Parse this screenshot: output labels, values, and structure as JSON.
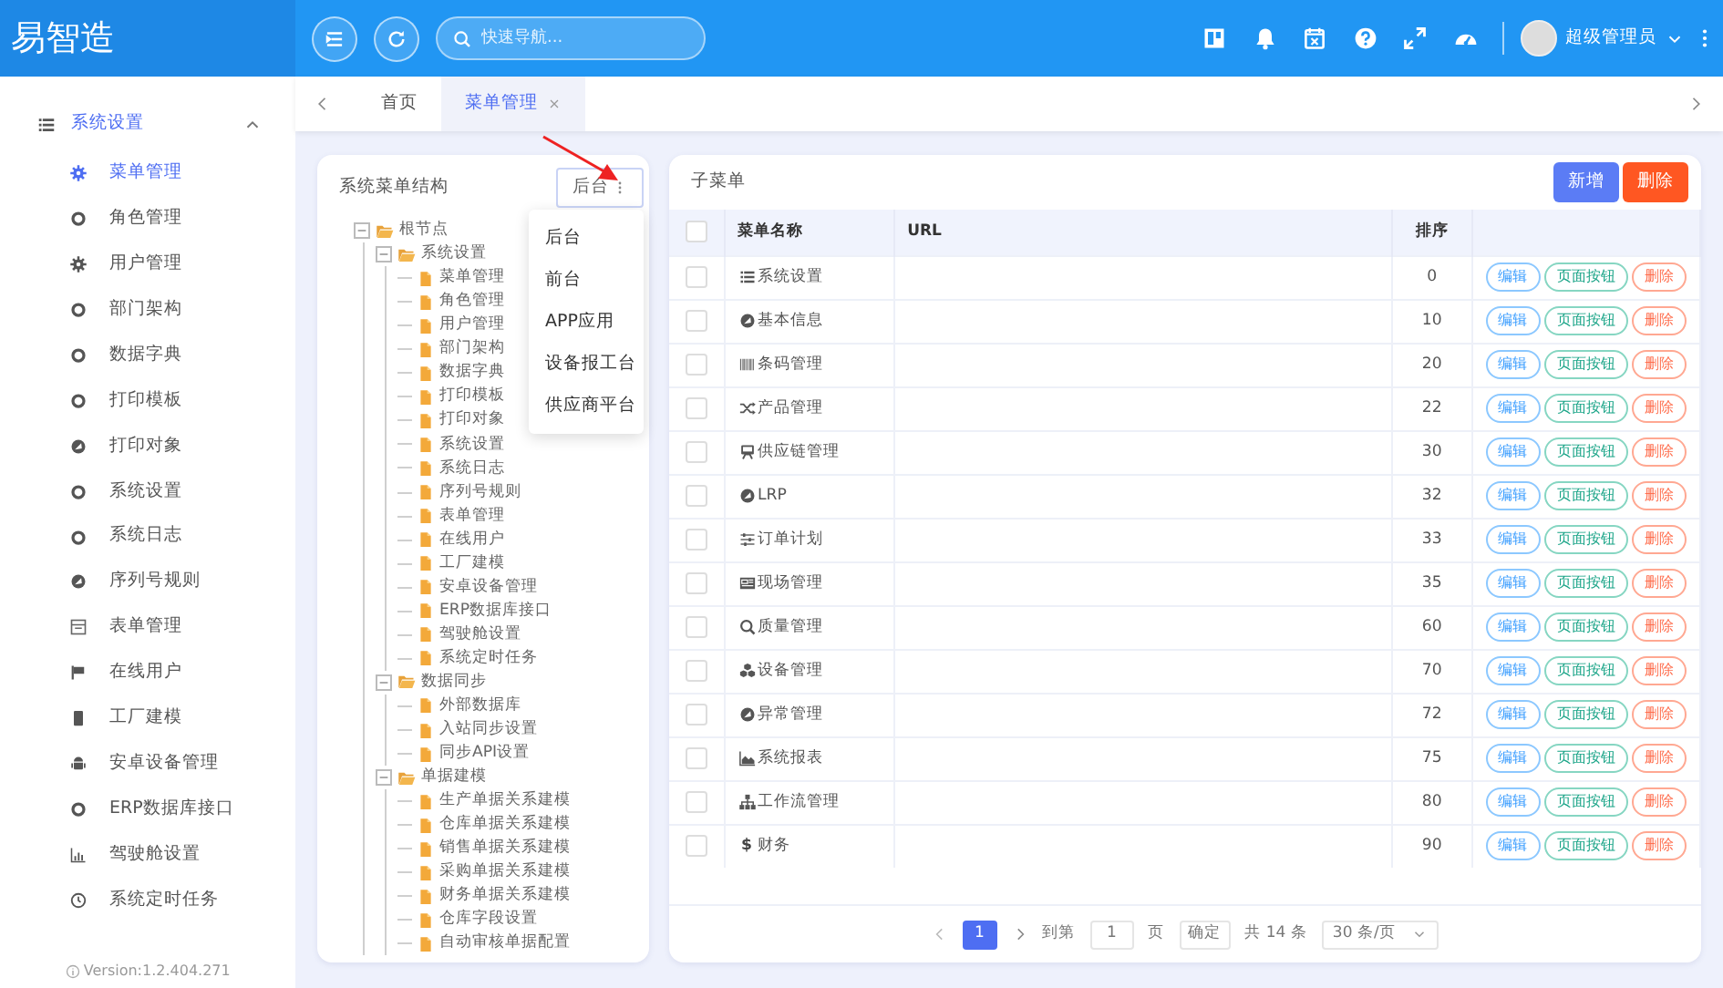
{
  "app": {
    "logo": "易智造"
  },
  "header": {
    "search_placeholder": "快速导航...",
    "user": "超级管理员"
  },
  "sidebar": {
    "group": {
      "label": "系统设置",
      "expanded": true
    },
    "items": [
      {
        "label": "菜单管理",
        "selected": true
      },
      {
        "label": "角色管理",
        "selected": false
      },
      {
        "label": "用户管理",
        "selected": false
      },
      {
        "label": "部门架构",
        "selected": false
      },
      {
        "label": "数据字典",
        "selected": false
      },
      {
        "label": "打印模板",
        "selected": false
      },
      {
        "label": "打印对象",
        "selected": false
      },
      {
        "label": "系统设置",
        "selected": false
      },
      {
        "label": "系统日志",
        "selected": false
      },
      {
        "label": "序列号规则",
        "selected": false
      },
      {
        "label": "表单管理",
        "selected": false
      },
      {
        "label": "在线用户",
        "selected": false
      },
      {
        "label": "工厂建模",
        "selected": false
      },
      {
        "label": "安卓设备管理",
        "selected": false
      },
      {
        "label": "ERP数据库接口",
        "selected": false
      },
      {
        "label": "驾驶舱设置",
        "selected": false
      },
      {
        "label": "系统定时任务",
        "selected": false
      }
    ],
    "version": "Version:1.2.404.271"
  },
  "tabs": [
    {
      "label": "首页",
      "selected": false,
      "closable": false
    },
    {
      "label": "菜单管理",
      "selected": true,
      "closable": true
    }
  ],
  "tree_panel": {
    "title": "系统菜单结构",
    "platform_button": "后台",
    "menu": [
      "后台",
      "前台",
      "APP应用",
      "设备报工台",
      "供应商平台"
    ],
    "tree": [
      {
        "label": "根节点",
        "kind": "folder",
        "expanded": true,
        "children": [
          {
            "label": "系统设置",
            "kind": "folder",
            "expanded": true,
            "children": [
              {
                "label": "菜单管理",
                "kind": "file"
              },
              {
                "label": "角色管理",
                "kind": "file"
              },
              {
                "label": "用户管理",
                "kind": "file"
              },
              {
                "label": "部门架构",
                "kind": "file"
              },
              {
                "label": "数据字典",
                "kind": "file"
              },
              {
                "label": "打印模板",
                "kind": "file"
              },
              {
                "label": "打印对象",
                "kind": "file"
              },
              {
                "label": "系统设置",
                "kind": "file"
              },
              {
                "label": "系统日志",
                "kind": "file"
              },
              {
                "label": "序列号规则",
                "kind": "file"
              },
              {
                "label": "表单管理",
                "kind": "file"
              },
              {
                "label": "在线用户",
                "kind": "file"
              },
              {
                "label": "工厂建模",
                "kind": "file"
              },
              {
                "label": "安卓设备管理",
                "kind": "file"
              },
              {
                "label": "ERP数据库接口",
                "kind": "file"
              },
              {
                "label": "驾驶舱设置",
                "kind": "file"
              },
              {
                "label": "系统定时任务",
                "kind": "file"
              }
            ]
          },
          {
            "label": "数据同步",
            "kind": "folder",
            "expanded": true,
            "children": [
              {
                "label": "外部数据库",
                "kind": "file"
              },
              {
                "label": "入站同步设置",
                "kind": "file"
              },
              {
                "label": "同步API设置",
                "kind": "file"
              }
            ]
          },
          {
            "label": "单据建模",
            "kind": "folder",
            "expanded": true,
            "children": [
              {
                "label": "生产单据关系建模",
                "kind": "file"
              },
              {
                "label": "仓库单据关系建模",
                "kind": "file"
              },
              {
                "label": "销售单据关系建模",
                "kind": "file"
              },
              {
                "label": "采购单据关系建模",
                "kind": "file"
              },
              {
                "label": "财务单据关系建模",
                "kind": "file"
              },
              {
                "label": "仓库字段设置",
                "kind": "file"
              },
              {
                "label": "自动审核单据配置",
                "kind": "file"
              }
            ]
          }
        ]
      }
    ]
  },
  "submenu_panel": {
    "title": "子菜单",
    "buttons": [
      {
        "label": "新增",
        "kind": "primary"
      },
      {
        "label": "删除",
        "kind": "danger"
      }
    ],
    "header_checked": false,
    "columns": [
      "菜单名称",
      "URL",
      "排序"
    ],
    "rows": [
      {
        "name": "系统设置",
        "sort": "0",
        "checked": false,
        "actions": [
          "编辑",
          "页面按钮",
          "删除"
        ]
      },
      {
        "name": "基本信息",
        "sort": "10",
        "checked": false,
        "actions": [
          "编辑",
          "页面按钮",
          "删除"
        ]
      },
      {
        "name": "条码管理",
        "sort": "20",
        "checked": false,
        "actions": [
          "编辑",
          "页面按钮",
          "删除"
        ]
      },
      {
        "name": "产品管理",
        "sort": "22",
        "checked": false,
        "actions": [
          "编辑",
          "页面按钮",
          "删除"
        ]
      },
      {
        "name": "供应链管理",
        "sort": "30",
        "checked": false,
        "actions": [
          "编辑",
          "页面按钮",
          "删除"
        ]
      },
      {
        "name": "LRP",
        "sort": "32",
        "checked": false,
        "actions": [
          "编辑",
          "页面按钮",
          "删除"
        ]
      },
      {
        "name": "订单计划",
        "sort": "33",
        "checked": false,
        "actions": [
          "编辑",
          "页面按钮",
          "删除"
        ]
      },
      {
        "name": "现场管理",
        "sort": "35",
        "checked": false,
        "actions": [
          "编辑",
          "页面按钮",
          "删除"
        ]
      },
      {
        "name": "质量管理",
        "sort": "60",
        "checked": false,
        "actions": [
          "编辑",
          "页面按钮",
          "删除"
        ]
      },
      {
        "name": "设备管理",
        "sort": "70",
        "checked": false,
        "actions": [
          "编辑",
          "页面按钮",
          "删除"
        ]
      },
      {
        "name": "异常管理",
        "sort": "72",
        "checked": false,
        "actions": [
          "编辑",
          "页面按钮",
          "删除"
        ]
      },
      {
        "name": "系统报表",
        "sort": "75",
        "checked": false,
        "actions": [
          "编辑",
          "页面按钮",
          "删除"
        ]
      },
      {
        "name": "工作流管理",
        "sort": "80",
        "checked": false,
        "actions": [
          "编辑",
          "页面按钮",
          "删除"
        ]
      },
      {
        "name": "财务",
        "sort": "90",
        "checked": false,
        "icon": "$",
        "actions": [
          "编辑",
          "页面按钮",
          "删除"
        ]
      }
    ],
    "pagination": {
      "pages": [
        {
          "label": "1",
          "selected": true
        }
      ],
      "goto_label": "到第",
      "goto_value": "1",
      "page_unit": "页",
      "confirm": "确定",
      "total": "共 14 条",
      "page_size": "30 条/页"
    }
  }
}
